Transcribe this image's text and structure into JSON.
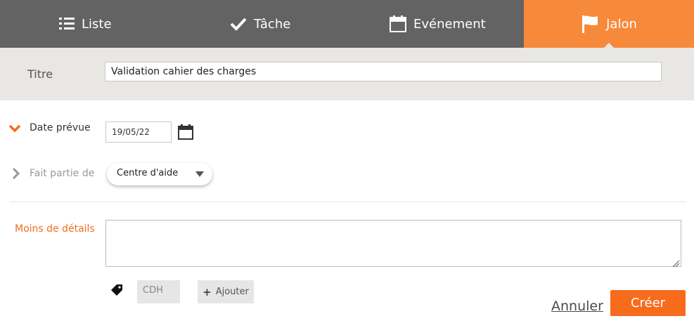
{
  "tabs": [
    {
      "label": "Liste",
      "icon": "list-icon"
    },
    {
      "label": "Tâche",
      "icon": "check-icon"
    },
    {
      "label": "Evénement",
      "icon": "calendar-icon"
    },
    {
      "label": "Jalon",
      "icon": "flag-icon",
      "active": true
    }
  ],
  "title": {
    "label": "Titre",
    "value": "Validation cahier des charges"
  },
  "date": {
    "label": "Date prévue",
    "value": "19/05/22",
    "icon": "calendar-icon"
  },
  "part_of": {
    "label": "Fait partie de",
    "value": "Centre d'aide"
  },
  "details": {
    "label": "Moins de détails",
    "value": ""
  },
  "tags": {
    "items": [
      "CDH"
    ],
    "add_label": "Ajouter",
    "icon": "tag-icon"
  },
  "actions": {
    "cancel": "Annuler",
    "create": "Créer"
  },
  "colors": {
    "accent": "#f76b1c",
    "active_tab": "#f7893b",
    "tab_bar": "#636363",
    "title_band": "#e9e7e4"
  }
}
